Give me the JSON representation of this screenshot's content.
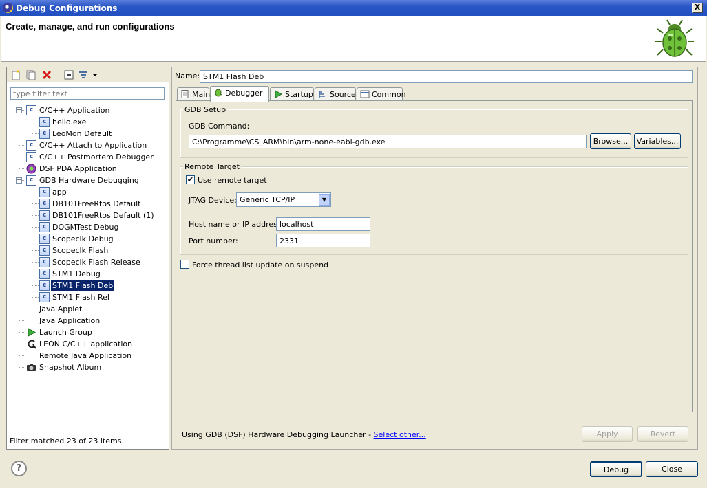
{
  "window": {
    "title": "Debug Configurations",
    "close_glyph": "X"
  },
  "banner": {
    "heading": "Create, manage, and run configurations"
  },
  "left": {
    "filter_placeholder": "type filter text",
    "status": "Filter matched 23 of 23 items",
    "tree": [
      {
        "label": "C/C++ Application",
        "level": 0,
        "icon": "c-app-icon",
        "expander": "−"
      },
      {
        "label": "hello.exe",
        "level": 1,
        "icon": "c-config-icon"
      },
      {
        "label": "LeoMon Default",
        "level": 1,
        "icon": "c-config-icon"
      },
      {
        "label": "C/C++ Attach to Application",
        "level": 0,
        "icon": "c-app-icon"
      },
      {
        "label": "C/C++ Postmortem Debugger",
        "level": 0,
        "icon": "c-app-icon"
      },
      {
        "label": "DSF PDA Application",
        "level": 0,
        "icon": "pda-icon"
      },
      {
        "label": "GDB Hardware Debugging",
        "level": 0,
        "icon": "c-app-icon",
        "expander": "−"
      },
      {
        "label": "app",
        "level": 1,
        "icon": "c-config-icon"
      },
      {
        "label": "DB101FreeRtos Default",
        "level": 1,
        "icon": "c-config-icon"
      },
      {
        "label": "DB101FreeRtos Default (1)",
        "level": 1,
        "icon": "c-config-icon"
      },
      {
        "label": "DOGMTest Debug",
        "level": 1,
        "icon": "c-config-icon"
      },
      {
        "label": "Scopeclk Debug",
        "level": 1,
        "icon": "c-config-icon"
      },
      {
        "label": "Scopeclk Flash",
        "level": 1,
        "icon": "c-config-icon"
      },
      {
        "label": "Scopeclk Flash Release",
        "level": 1,
        "icon": "c-config-icon"
      },
      {
        "label": "STM1 Debug",
        "level": 1,
        "icon": "c-config-icon"
      },
      {
        "label": "STM1 Flash Deb",
        "level": 1,
        "icon": "c-config-icon",
        "selected": true
      },
      {
        "label": "STM1 Flash Rel",
        "level": 1,
        "icon": "c-config-icon"
      },
      {
        "label": "Java Applet",
        "level": 0,
        "icon": "none"
      },
      {
        "label": "Java Application",
        "level": 0,
        "icon": "none"
      },
      {
        "label": "Launch Group",
        "level": 0,
        "icon": "launch-group-icon"
      },
      {
        "label": "LEON C/C++ application",
        "level": 0,
        "icon": "leon-icon"
      },
      {
        "label": "Remote Java Application",
        "level": 0,
        "icon": "none"
      },
      {
        "label": "Snapshot Album",
        "level": 0,
        "icon": "camera-icon"
      }
    ]
  },
  "right": {
    "name_label": "Name:",
    "name_value": "STM1 Flash Deb",
    "tabs": [
      {
        "label": "Main",
        "icon": "main-tab-icon"
      },
      {
        "label": "Debugger",
        "icon": "debugger-tab-icon",
        "active": true
      },
      {
        "label": "Startup",
        "icon": "startup-tab-icon"
      },
      {
        "label": "Source",
        "icon": "source-tab-icon"
      },
      {
        "label": "Common",
        "icon": "common-tab-icon"
      }
    ],
    "gdb_setup": {
      "title": "GDB Setup",
      "command_label": "GDB Command:",
      "command_value": "C:\\Programme\\CS_ARM\\bin\\arm-none-eabi-gdb.exe",
      "browse": "Browse...",
      "variables": "Variables..."
    },
    "remote": {
      "title": "Remote Target",
      "use_remote": "Use remote target",
      "use_remote_checked": true,
      "jtag_label": "JTAG Device:",
      "jtag_value": "Generic TCP/IP",
      "host_label": "Host name or IP address:",
      "host_value": "localhost",
      "port_label": "Port number:",
      "port_value": "2331"
    },
    "force_thread": "Force thread list update on suspend",
    "force_thread_checked": false,
    "launcher_text": "Using GDB (DSF) Hardware Debugging Launcher - ",
    "launcher_link": "Select other...",
    "apply": "Apply",
    "revert": "Revert"
  },
  "footer": {
    "help_glyph": "?",
    "debug": "Debug",
    "close": "Close"
  }
}
